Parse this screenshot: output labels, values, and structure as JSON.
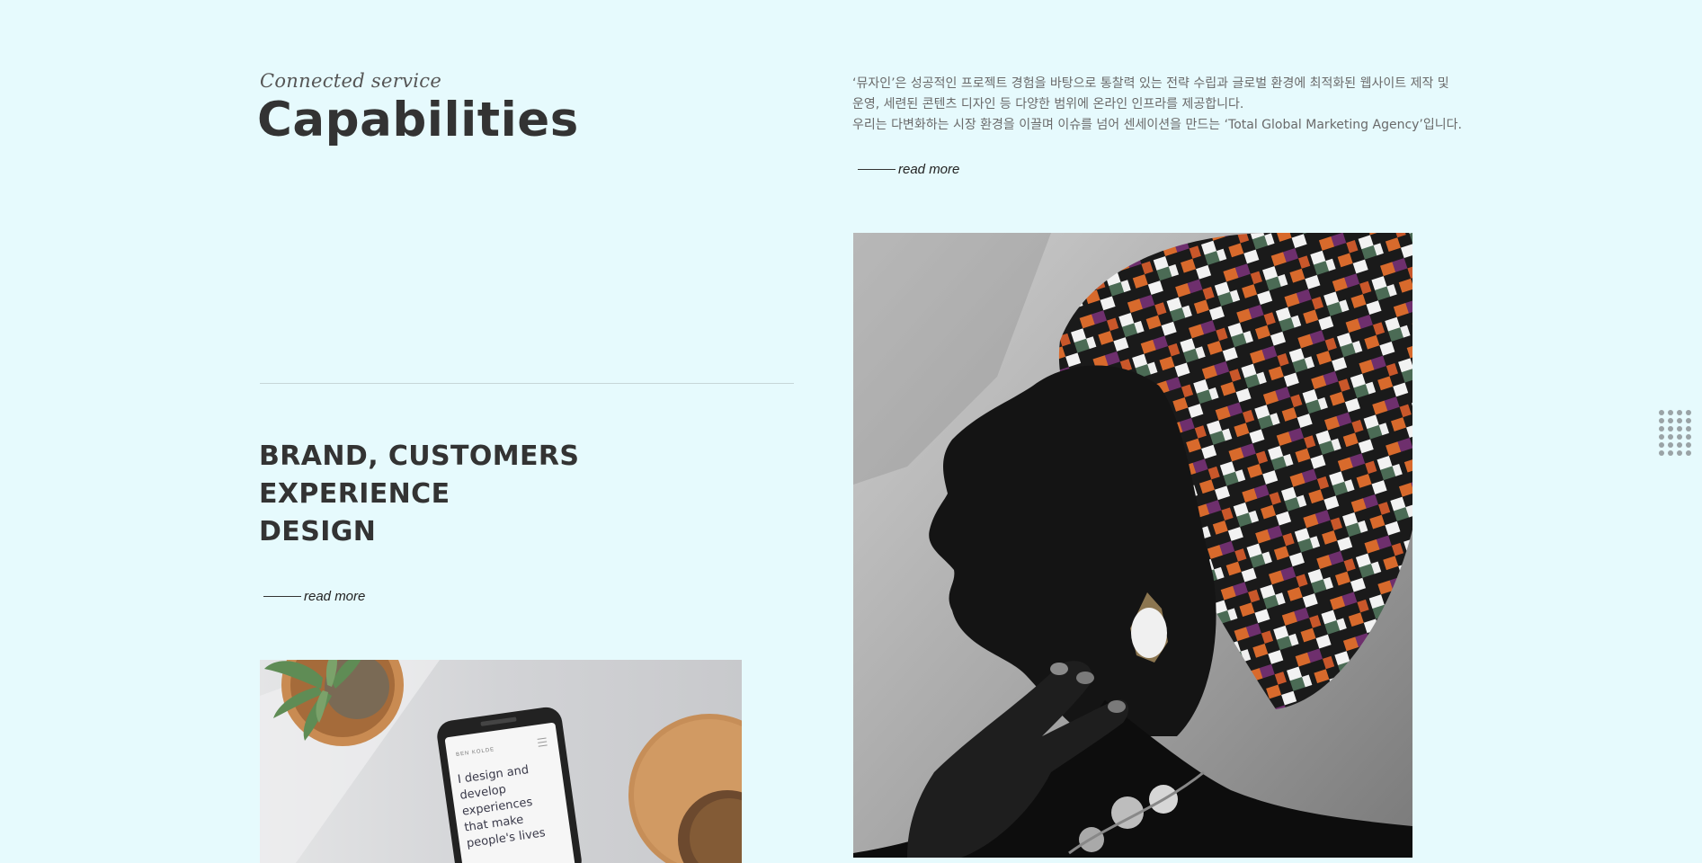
{
  "header": {
    "eyebrow": "Connected service",
    "title": "Capabilities"
  },
  "intro": {
    "lines": [
      "‘뮤자인’은 성공적인 프로젝트 경험을 바탕으로 통찰력 있는 전략 수립과 글로벌 환경에 최적화된 웹사이트 제작 및",
      "운영, 세련된 콘텐츠 디자인 등 다양한 범위에 온라인 인프라를 제공합니다.",
      "우리는 다변화하는 시장 환경을 이끌며 이슈를 넘어 센세이션을 만드는 ‘Total Global Marketing Agency’입니다."
    ],
    "read_more": "read more"
  },
  "section": {
    "heading_lines": [
      "BRAND, CUSTOMERS",
      "EXPERIENCE",
      "DESIGN"
    ],
    "read_more": "read more"
  },
  "images": {
    "portrait": "woman-headwrap-photo",
    "desk": "phone-desk-photo",
    "phone_screen": {
      "site": "BEN KOLDE",
      "text_lines": [
        "I design and",
        "develop",
        "experiences",
        "that make",
        "people's lives"
      ]
    }
  },
  "icons": {
    "menu": "grid-menu-icon"
  },
  "colors": {
    "background": "#e6fafd",
    "text_dark": "#333333",
    "text_muted": "#6a6a6a",
    "divider": "#c6d6d8"
  }
}
